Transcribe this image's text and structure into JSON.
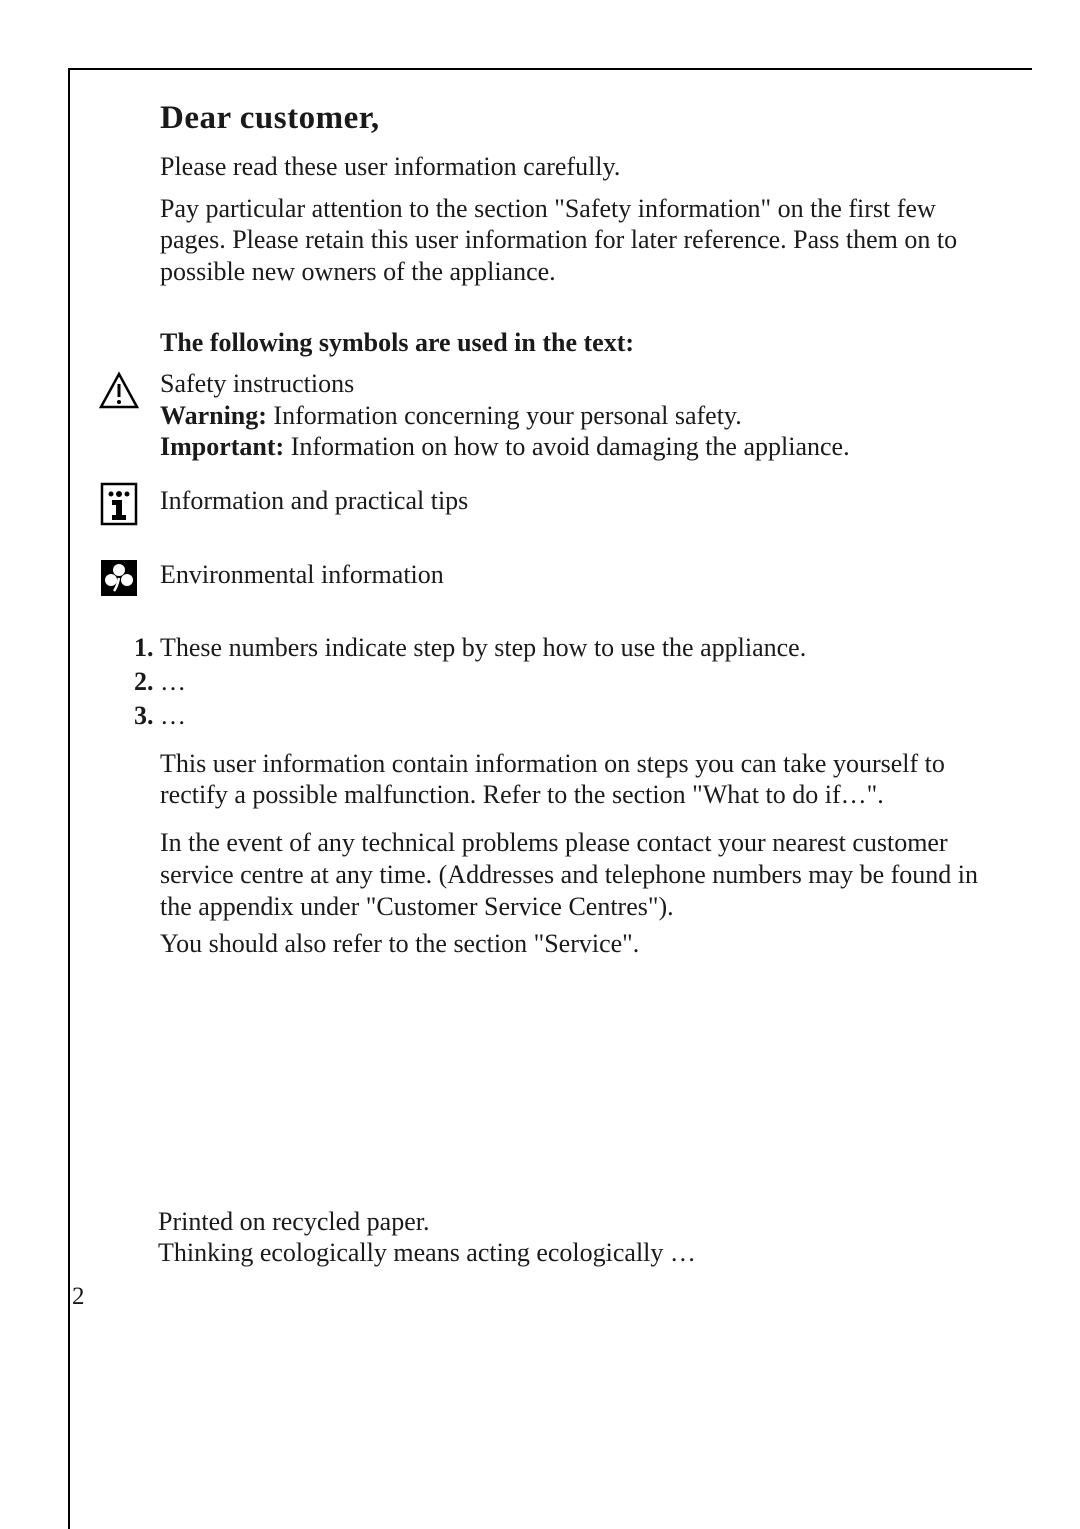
{
  "heading": "Dear customer,",
  "intro_1": "Please read these user information carefully.",
  "intro_2": "Pay particular attention to the section \"Safety information\" on the first few pages. Please retain this user information for later reference. Pass them on to possible new owners of the appliance.",
  "subheading": "The following symbols are used in the text:",
  "safety": {
    "title": "Safety instructions",
    "warning_label": "Warning:",
    "warning_text": " Information concerning your personal safety.",
    "important_label": "Important:",
    "important_text": " Information on how to avoid damaging the appliance."
  },
  "info_tips": "Information and practical tips",
  "environmental": "Environmental information",
  "steps": {
    "num1": "1.",
    "text1": "These numbers indicate step by step how to use the appliance.",
    "num2": "2.",
    "text2": "…",
    "num3": "3.",
    "text3": "…"
  },
  "para_1": "This user information contain information on steps you can take yourself to rectify a possible malfunction. Refer to the section \"What to do if…\".",
  "para_2": "In the event of any technical problems please contact your nearest customer service centre at any time. (Addresses and telephone numbers may be found in the appendix under \"Customer Service Centres\").",
  "para_3": "You should also refer to the section \"Service\".",
  "footer_1": "Printed on recycled paper.",
  "footer_2": "Thinking ecologically means acting ecologically …",
  "page_number": "2"
}
